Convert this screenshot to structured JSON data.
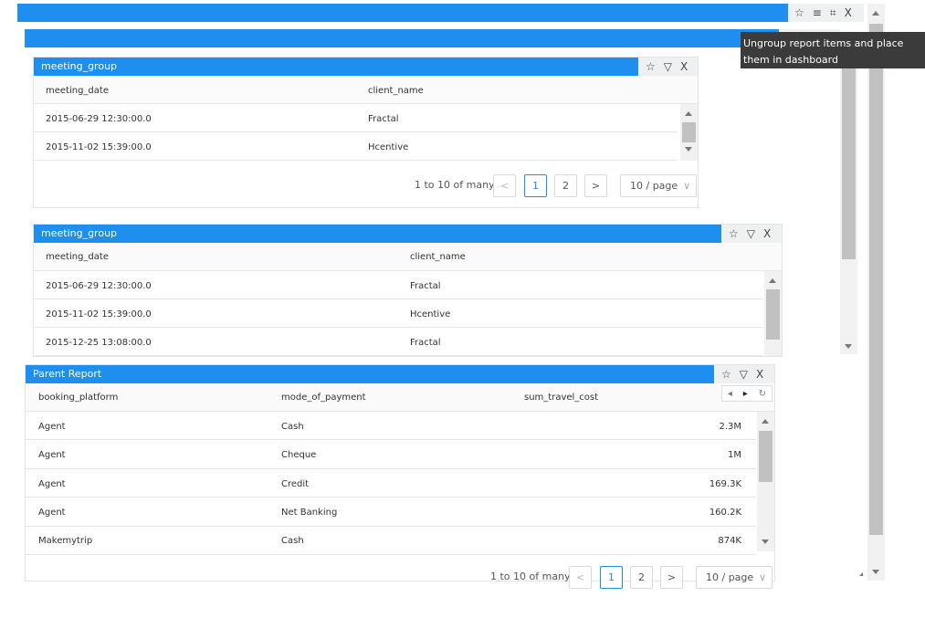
{
  "dashboard": {
    "toolbar_icons": [
      "pin-icon",
      "list-icon",
      "ungroup-icon",
      "close-icon"
    ],
    "tooltip": "Ungroup report items and place them in dashboard"
  },
  "panels": [
    {
      "title": "meeting_group",
      "columns": [
        "meeting_date",
        "client_name"
      ],
      "rows": [
        [
          "2015-06-29 12:30:00.0",
          "Fractal"
        ],
        [
          "2015-11-02 15:39:00.0",
          "Hcentive"
        ]
      ],
      "pagination": {
        "summary": "1 to 10 of many",
        "prev": "<",
        "pages": [
          "1",
          "2"
        ],
        "next": ">",
        "page_size": "10 / page"
      }
    },
    {
      "title": "meeting_group",
      "columns": [
        "meeting_date",
        "client_name"
      ],
      "rows": [
        [
          "2015-06-29 12:30:00.0",
          "Fractal"
        ],
        [
          "2015-11-02 15:39:00.0",
          "Hcentive"
        ],
        [
          "2015-12-25 13:08:00.0",
          "Fractal"
        ]
      ]
    },
    {
      "title": "Parent Report",
      "columns": [
        "booking_platform",
        "mode_of_payment",
        "sum_travel_cost"
      ],
      "rows": [
        [
          "Agent",
          "Cash",
          "2.3M"
        ],
        [
          "Agent",
          "Cheque",
          "1M"
        ],
        [
          "Agent",
          "Credit",
          "169.3K"
        ],
        [
          "Agent",
          "Net Banking",
          "160.2K"
        ],
        [
          "Makemytrip",
          "Cash",
          "874K"
        ]
      ],
      "pagination": {
        "summary": "1 to 10 of many",
        "prev": "<",
        "pages": [
          "1",
          "2"
        ],
        "next": ">",
        "page_size": "10 / page"
      }
    }
  ],
  "glyphs": {
    "pin": "☆",
    "filter": "▽",
    "close": "X",
    "list": "≡",
    "ungroup": "⌗",
    "chev": "∨",
    "nav_left": "◂",
    "nav_right": "▸",
    "refresh": "↻"
  }
}
